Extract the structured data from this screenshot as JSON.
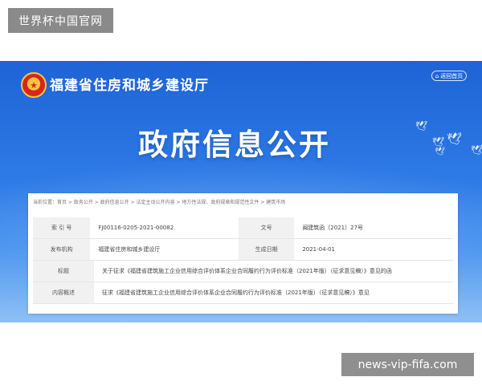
{
  "site_badge": "世界杯中国官网",
  "watermark": "news-vip-fifa.com",
  "header": {
    "department": "福建省住房和城乡建设厅",
    "back_button": "返回首页",
    "banner_title": "政府信息公开"
  },
  "breadcrumb": "当前位置：首页 > 政务公开 > 政府信息公开 > 法定主动公开内容 > 地方性法规、政府规章和规范性文件 > 建筑市场",
  "info_table": {
    "index_label": "索 引 号",
    "index_value": "FJ00116-0205-2021-00082",
    "docno_label": "文号",
    "docno_value": "闽建筑函〔2021〕27号",
    "org_label": "发布机构",
    "org_value": "福建省住房和城乡建设厅",
    "date_label": "生成日期",
    "date_value": "2021-04-01",
    "title_label": "标题",
    "title_value": "关于征求《福建省建筑施工企业信用综合评价体系企业合同履约行为评价标准（2021年版）（征求意见稿）》意见的函",
    "summary_label": "内容概述",
    "summary_value": "征求《福建省建筑施工企业信用综合评价体系企业合同履约行为评价标准（2021年版）（征求意见稿）》意见"
  },
  "icons": {
    "emblem": "national-emblem-icon",
    "home": "home-icon",
    "doves": "dove-icon"
  }
}
